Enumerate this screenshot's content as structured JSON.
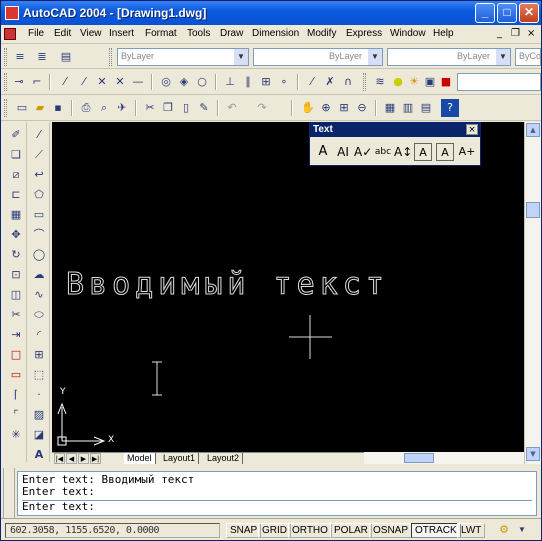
{
  "window": {
    "title": "AutoCAD 2004 - [Drawing1.dwg]",
    "controls": {
      "minimize": "_",
      "maximize": "□",
      "close": "✕"
    }
  },
  "menu": {
    "items": [
      "File",
      "Edit",
      "View",
      "Insert",
      "Format",
      "Tools",
      "Draw",
      "Dimension",
      "Modify",
      "Express",
      "Window",
      "Help"
    ],
    "doc_controls": {
      "minimize": "_",
      "restore": "❐",
      "close": "×"
    }
  },
  "properties_toolbar": {
    "layer_combo": "ByLayer",
    "linetype_combo": "ByLayer",
    "lineweight_combo": "ByLayer",
    "plotstyle_combo": "ByCo"
  },
  "text_toolbar": {
    "title": "Text",
    "close": "×",
    "buttons": [
      "A",
      "AI",
      "A✓",
      "abc",
      "A↕",
      "A",
      "A",
      "A+"
    ]
  },
  "drawing": {
    "text": "Вводимый текст",
    "ucs_x": "X",
    "ucs_y": "Y"
  },
  "tabs": {
    "items": [
      "Model",
      "Layout1",
      "Layout2"
    ],
    "active": "Model"
  },
  "command": {
    "lines": [
      "Enter text: Вводимый текст",
      "Enter text:",
      "Enter text:"
    ]
  },
  "status": {
    "coords": "602.3058, 1155.6520, 0.0000",
    "modes": [
      "SNAP",
      "GRID",
      "ORTHO",
      "POLAR",
      "OSNAP",
      "OTRACK",
      "LWT"
    ],
    "active_mode": "OTRACK"
  },
  "colors": {
    "titlebar": "#0b52d0",
    "canvas": "#000000",
    "canvas_text": "#dddddd"
  }
}
